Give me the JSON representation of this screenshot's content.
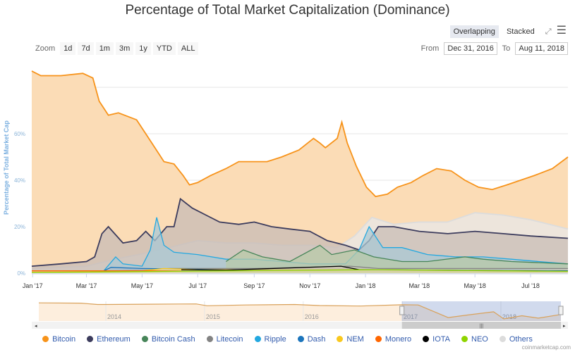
{
  "chart_data": {
    "type": "area",
    "title": "Percentage of Total Market Capitalization (Dominance)",
    "ylabel": "Percentage of Total Market Cap",
    "ylim": [
      0,
      90
    ],
    "yticks": [
      "0%",
      "20%",
      "40%",
      "60%"
    ],
    "ytick_values": [
      0,
      20,
      40,
      60,
      80
    ],
    "xlim": [
      "2016-12-31",
      "2018-08-11"
    ],
    "xticks": [
      [
        "2017-01-01",
        "Jan '17"
      ],
      [
        "2017-03-01",
        "Mar '17"
      ],
      [
        "2017-05-01",
        "May '17"
      ],
      [
        "2017-07-01",
        "Jul '17"
      ],
      [
        "2017-09-01",
        "Sep '17"
      ],
      [
        "2017-11-01",
        "Nov '17"
      ],
      [
        "2018-01-01",
        "Jan '18"
      ],
      [
        "2018-03-01",
        "Mar '18"
      ],
      [
        "2018-05-01",
        "May '18"
      ],
      [
        "2018-07-01",
        "Jul '18"
      ]
    ],
    "grid": true,
    "legend_position": "bottom",
    "series": [
      {
        "name": "Bitcoin",
        "color": "#f7931a",
        "fill": "#fbdcb6",
        "points": [
          [
            "2016-12-31",
            87
          ],
          [
            "2017-01-10",
            85
          ],
          [
            "2017-02-01",
            85
          ],
          [
            "2017-02-25",
            86
          ],
          [
            "2017-03-08",
            84
          ],
          [
            "2017-03-15",
            74
          ],
          [
            "2017-03-25",
            68
          ],
          [
            "2017-04-05",
            69
          ],
          [
            "2017-04-25",
            66
          ],
          [
            "2017-05-05",
            60
          ],
          [
            "2017-05-15",
            54
          ],
          [
            "2017-05-25",
            48
          ],
          [
            "2017-06-05",
            47
          ],
          [
            "2017-06-15",
            42
          ],
          [
            "2017-06-22",
            38
          ],
          [
            "2017-07-01",
            39
          ],
          [
            "2017-07-15",
            42
          ],
          [
            "2017-08-01",
            45
          ],
          [
            "2017-08-15",
            48
          ],
          [
            "2017-09-01",
            48
          ],
          [
            "2017-09-15",
            48
          ],
          [
            "2017-10-01",
            50
          ],
          [
            "2017-10-20",
            53
          ],
          [
            "2017-11-05",
            58
          ],
          [
            "2017-11-12",
            56
          ],
          [
            "2017-11-18",
            54
          ],
          [
            "2017-12-01",
            58
          ],
          [
            "2017-12-06",
            65
          ],
          [
            "2017-12-12",
            56
          ],
          [
            "2017-12-22",
            46
          ],
          [
            "2018-01-02",
            37
          ],
          [
            "2018-01-12",
            33
          ],
          [
            "2018-01-25",
            34
          ],
          [
            "2018-02-05",
            37
          ],
          [
            "2018-02-20",
            39
          ],
          [
            "2018-03-05",
            42
          ],
          [
            "2018-03-20",
            45
          ],
          [
            "2018-04-05",
            44
          ],
          [
            "2018-04-20",
            40
          ],
          [
            "2018-05-05",
            37
          ],
          [
            "2018-05-20",
            36
          ],
          [
            "2018-06-05",
            38
          ],
          [
            "2018-06-20",
            40
          ],
          [
            "2018-07-05",
            42
          ],
          [
            "2018-07-25",
            45
          ],
          [
            "2018-08-11",
            50
          ]
        ]
      },
      {
        "name": "Others",
        "color": "#dcdcdc",
        "fill": "#e8e8e8",
        "points": [
          [
            "2016-12-31",
            2
          ],
          [
            "2017-03-01",
            3
          ],
          [
            "2017-04-01",
            6
          ],
          [
            "2017-05-10",
            9
          ],
          [
            "2017-06-10",
            12
          ],
          [
            "2017-07-01",
            14
          ],
          [
            "2017-08-01",
            13
          ],
          [
            "2017-09-01",
            13
          ],
          [
            "2017-10-01",
            12
          ],
          [
            "2017-11-01",
            12
          ],
          [
            "2017-12-01",
            11
          ],
          [
            "2017-12-20",
            16
          ],
          [
            "2018-01-08",
            24
          ],
          [
            "2018-02-01",
            21
          ],
          [
            "2018-03-01",
            22
          ],
          [
            "2018-04-01",
            22
          ],
          [
            "2018-05-01",
            26
          ],
          [
            "2018-06-01",
            25
          ],
          [
            "2018-07-01",
            23
          ],
          [
            "2018-08-11",
            19
          ]
        ]
      },
      {
        "name": "Ethereum",
        "color": "#3c3c5d",
        "fill": "#c8bcb6",
        "points": [
          [
            "2016-12-31",
            3
          ],
          [
            "2017-02-01",
            4
          ],
          [
            "2017-03-01",
            5
          ],
          [
            "2017-03-10",
            7
          ],
          [
            "2017-03-18",
            17
          ],
          [
            "2017-03-25",
            20
          ],
          [
            "2017-04-10",
            13
          ],
          [
            "2017-04-25",
            14
          ],
          [
            "2017-05-05",
            18
          ],
          [
            "2017-05-15",
            14
          ],
          [
            "2017-05-28",
            20
          ],
          [
            "2017-06-05",
            20
          ],
          [
            "2017-06-12",
            32
          ],
          [
            "2017-06-25",
            28
          ],
          [
            "2017-07-10",
            25
          ],
          [
            "2017-07-25",
            22
          ],
          [
            "2017-08-15",
            21
          ],
          [
            "2017-09-01",
            22
          ],
          [
            "2017-09-20",
            20
          ],
          [
            "2017-10-10",
            19
          ],
          [
            "2017-11-01",
            18
          ],
          [
            "2017-11-20",
            14
          ],
          [
            "2017-12-10",
            12
          ],
          [
            "2017-12-25",
            10
          ],
          [
            "2018-01-05",
            14
          ],
          [
            "2018-01-15",
            20
          ],
          [
            "2018-02-01",
            20
          ],
          [
            "2018-03-01",
            18
          ],
          [
            "2018-04-01",
            17
          ],
          [
            "2018-05-01",
            18
          ],
          [
            "2018-06-01",
            17
          ],
          [
            "2018-07-01",
            16
          ],
          [
            "2018-08-11",
            15
          ]
        ]
      },
      {
        "name": "Ripple",
        "color": "#23a8e0",
        "fill": "#a9c8d4",
        "points": [
          [
            "2016-12-31",
            1
          ],
          [
            "2017-03-20",
            1
          ],
          [
            "2017-04-02",
            7
          ],
          [
            "2017-04-10",
            4
          ],
          [
            "2017-05-01",
            3
          ],
          [
            "2017-05-10",
            10
          ],
          [
            "2017-05-17",
            24
          ],
          [
            "2017-05-25",
            12
          ],
          [
            "2017-06-05",
            9
          ],
          [
            "2017-07-01",
            8
          ],
          [
            "2017-08-01",
            6
          ],
          [
            "2017-09-01",
            6
          ],
          [
            "2017-10-01",
            5
          ],
          [
            "2017-11-01",
            4
          ],
          [
            "2017-12-10",
            4
          ],
          [
            "2017-12-25",
            10
          ],
          [
            "2018-01-05",
            20
          ],
          [
            "2018-01-20",
            11
          ],
          [
            "2018-02-10",
            11
          ],
          [
            "2018-03-10",
            8
          ],
          [
            "2018-04-10",
            7
          ],
          [
            "2018-05-10",
            7
          ],
          [
            "2018-06-10",
            6
          ],
          [
            "2018-07-10",
            5
          ],
          [
            "2018-08-11",
            4
          ]
        ]
      },
      {
        "name": "Bitcoin Cash",
        "color": "#478559",
        "fill": "#b8c9a8",
        "points": [
          [
            "2017-08-01",
            5
          ],
          [
            "2017-08-20",
            10
          ],
          [
            "2017-09-10",
            7
          ],
          [
            "2017-10-10",
            5
          ],
          [
            "2017-11-12",
            12
          ],
          [
            "2017-11-25",
            8
          ],
          [
            "2017-12-20",
            10
          ],
          [
            "2018-01-10",
            7
          ],
          [
            "2018-02-10",
            5
          ],
          [
            "2018-03-10",
            5
          ],
          [
            "2018-04-20",
            7
          ],
          [
            "2018-05-10",
            6
          ],
          [
            "2018-06-10",
            5
          ],
          [
            "2018-08-11",
            4
          ]
        ]
      },
      {
        "name": "Litecoin",
        "color": "#838383",
        "fill": "#c8c4bc",
        "points": [
          [
            "2016-12-31",
            1
          ],
          [
            "2017-04-01",
            1
          ],
          [
            "2017-06-01",
            2
          ],
          [
            "2017-09-01",
            2
          ],
          [
            "2017-12-15",
            3
          ],
          [
            "2018-01-15",
            2
          ],
          [
            "2018-05-01",
            2
          ],
          [
            "2018-08-11",
            2
          ]
        ]
      },
      {
        "name": "Dash",
        "color": "#1c75bc",
        "fill": "#b0bfcb",
        "points": [
          [
            "2016-12-31",
            1
          ],
          [
            "2017-03-20",
            1
          ],
          [
            "2017-03-28",
            2.5
          ],
          [
            "2017-05-01",
            2
          ],
          [
            "2017-08-01",
            1.5
          ],
          [
            "2017-12-20",
            1.5
          ],
          [
            "2018-08-11",
            1
          ]
        ]
      },
      {
        "name": "NEM",
        "color": "#f9c81e",
        "fill": "#f0d8a0",
        "points": [
          [
            "2016-12-31",
            0.5
          ],
          [
            "2017-05-01",
            1
          ],
          [
            "2017-05-25",
            2
          ],
          [
            "2017-07-01",
            1.5
          ],
          [
            "2018-01-05",
            1.5
          ],
          [
            "2018-08-11",
            0.5
          ]
        ]
      },
      {
        "name": "Monero",
        "color": "#ff6600",
        "fill": "#f3c9a4",
        "points": [
          [
            "2016-12-31",
            1
          ],
          [
            "2017-05-01",
            1
          ],
          [
            "2017-10-01",
            0.8
          ],
          [
            "2018-08-11",
            0.6
          ]
        ]
      },
      {
        "name": "IOTA",
        "color": "#000000",
        "fill": "#ccc0b0",
        "points": [
          [
            "2017-06-13",
            1.5
          ],
          [
            "2017-08-01",
            1.3
          ],
          [
            "2017-12-05",
            3
          ],
          [
            "2017-12-25",
            1.5
          ],
          [
            "2018-08-11",
            0.8
          ]
        ]
      },
      {
        "name": "NEO",
        "color": "#8fd400",
        "fill": "#d4dca8",
        "points": [
          [
            "2016-12-31",
            0.3
          ],
          [
            "2017-08-01",
            1
          ],
          [
            "2018-01-15",
            1.5
          ],
          [
            "2018-08-11",
            0.8
          ]
        ]
      }
    ],
    "navigator": {
      "xlim": [
        "2013-04-28",
        "2018-08-11"
      ],
      "labels": [
        [
          "2014-01-01",
          "2014"
        ],
        [
          "2015-01-01",
          "2015"
        ],
        [
          "2016-01-01",
          "2016"
        ],
        [
          "2017-01-01",
          "2017"
        ],
        [
          "2018-01-01",
          "2018"
        ]
      ],
      "selection": [
        "2016-12-31",
        "2018-08-11"
      ],
      "points": [
        [
          "2013-04-28",
          94
        ],
        [
          "2013-10-01",
          93
        ],
        [
          "2013-12-01",
          88
        ],
        [
          "2014-01-01",
          88
        ],
        [
          "2014-06-01",
          89
        ],
        [
          "2014-12-01",
          90
        ],
        [
          "2015-01-10",
          83
        ],
        [
          "2015-06-01",
          86
        ],
        [
          "2015-12-01",
          88
        ],
        [
          "2016-03-01",
          84
        ],
        [
          "2016-08-01",
          82
        ],
        [
          "2016-12-31",
          87
        ],
        [
          "2017-03-01",
          86
        ],
        [
          "2017-06-20",
          38
        ],
        [
          "2017-09-01",
          48
        ],
        [
          "2017-12-05",
          60
        ],
        [
          "2018-01-12",
          33
        ],
        [
          "2018-03-20",
          45
        ],
        [
          "2018-05-20",
          36
        ],
        [
          "2018-08-11",
          50
        ]
      ]
    }
  },
  "toolbar": {
    "overlapping": "Overlapping",
    "stacked": "Stacked",
    "fullscreen_icon": "fullscreen-icon",
    "menu_icon": "menu-icon"
  },
  "zoom": {
    "label": "Zoom",
    "buttons": [
      "1d",
      "7d",
      "1m",
      "3m",
      "1y",
      "YTD",
      "ALL"
    ]
  },
  "range": {
    "from_label": "From",
    "from": "Dec 31, 2016",
    "to_label": "To",
    "to": "Aug 11, 2018"
  },
  "credit": "coinmarketcap.com"
}
